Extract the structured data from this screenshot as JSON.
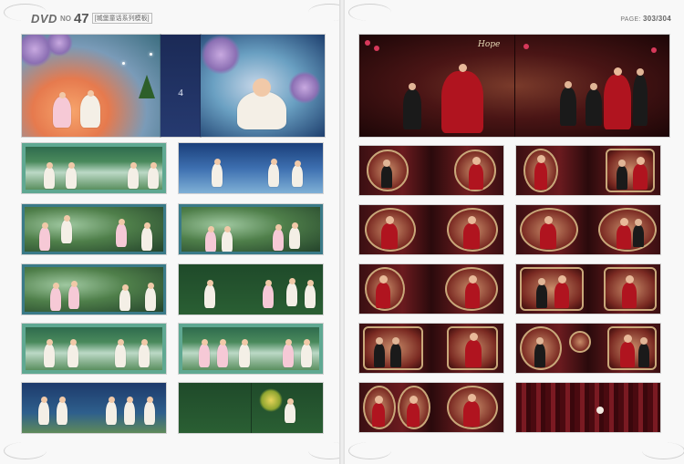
{
  "header_left": {
    "brand": "DVD",
    "no_label": "NO",
    "issue_number": "47",
    "title": "[城堡童话系列模板]"
  },
  "header_right": {
    "page_label": "PAGE:",
    "page_numbers": "303/304"
  },
  "left_page": {
    "hero_title_badge": "4"
  },
  "right_page": {
    "hero_script": "Hope"
  }
}
